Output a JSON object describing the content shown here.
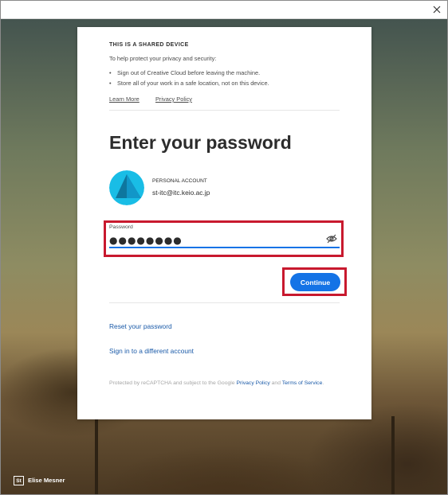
{
  "shared_device": {
    "title": "THIS IS A SHARED DEVICE",
    "intro": "To help protect your privacy and security:",
    "bullets": [
      "Sign out of Creative Cloud before leaving the machine.",
      "Store all of your work in a safe location, not on this device."
    ],
    "learn_more": "Learn More",
    "privacy_policy": "Privacy Policy"
  },
  "heading": "Enter your password",
  "account": {
    "type": "PERSONAL ACCOUNT",
    "email": "st-itc@itc.keio.ac.jp"
  },
  "password": {
    "label": "Password",
    "masked_value": "●●●●●●●●"
  },
  "continue_label": "Continue",
  "reset_password": "Reset your password",
  "different_account": "Sign in to a different account",
  "recaptcha": {
    "prefix": "Protected by reCAPTCHA and subject to the Google ",
    "privacy_link": "Privacy Policy",
    "middle": " and ",
    "terms_link": "Terms of Service",
    "suffix": "."
  },
  "footer": {
    "badge": "St",
    "photographer": "Elise Mesner"
  },
  "colors": {
    "accent": "#1473e6",
    "highlight": "#c8192e",
    "link": "#1a5aa8"
  }
}
